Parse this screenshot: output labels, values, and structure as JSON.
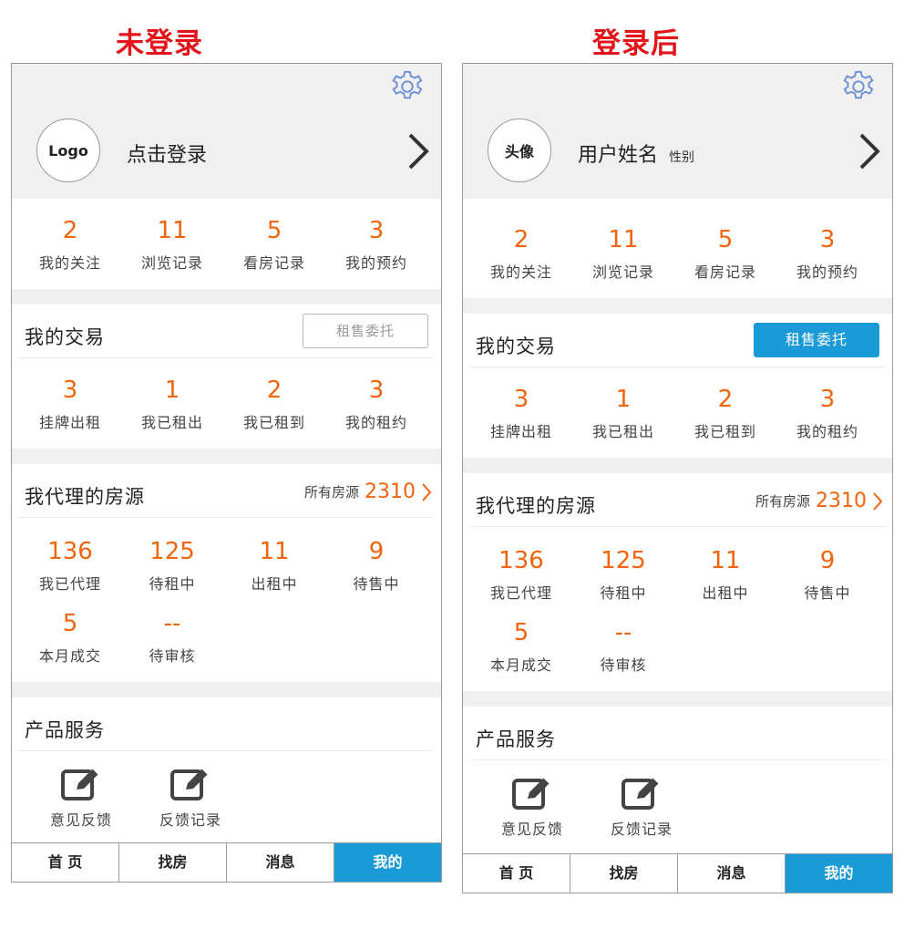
{
  "captions": {
    "before": "未登录",
    "after": "登录后"
  },
  "colors": {
    "accent_orange": "#f0640c",
    "accent_blue": "#1a9bd7",
    "caption_red": "#e3151b"
  },
  "before": {
    "avatar_text": "Logo",
    "name": "点击登录",
    "gender": "",
    "stats": [
      {
        "num": "2",
        "label": "我的关注"
      },
      {
        "num": "11",
        "label": "浏览记录"
      },
      {
        "num": "5",
        "label": "看房记录"
      },
      {
        "num": "3",
        "label": "我的预约"
      }
    ],
    "trade": {
      "title": "我的交易",
      "button": "租售委托",
      "button_state": "disabled",
      "stats": [
        {
          "num": "3",
          "label": "挂牌出租"
        },
        {
          "num": "1",
          "label": "我已租出"
        },
        {
          "num": "2",
          "label": "我已租到"
        },
        {
          "num": "3",
          "label": "我的租约"
        }
      ]
    },
    "agency": {
      "title": "我代理的房源",
      "all_label": "所有房源",
      "all_count": "2310",
      "stats": [
        {
          "num": "136",
          "label": "我已代理"
        },
        {
          "num": "125",
          "label": "待租中"
        },
        {
          "num": "11",
          "label": "出租中"
        },
        {
          "num": "9",
          "label": "待售中"
        },
        {
          "num": "5",
          "label": "本月成交"
        },
        {
          "num": "--",
          "label": "待审核"
        }
      ]
    },
    "services": {
      "title": "产品服务",
      "items": [
        {
          "label": "意见反馈",
          "icon": "edit-icon"
        },
        {
          "label": "反馈记录",
          "icon": "edit-icon"
        }
      ]
    },
    "tabs": [
      "首 页",
      "找房",
      "消息",
      "我的"
    ],
    "active_tab": 3
  },
  "after": {
    "avatar_text": "头像",
    "name": "用户姓名",
    "gender": "性别",
    "stats": [
      {
        "num": "2",
        "label": "我的关注"
      },
      {
        "num": "11",
        "label": "浏览记录"
      },
      {
        "num": "5",
        "label": "看房记录"
      },
      {
        "num": "3",
        "label": "我的预约"
      }
    ],
    "trade": {
      "title": "我的交易",
      "button": "租售委托",
      "button_state": "enabled",
      "stats": [
        {
          "num": "3",
          "label": "挂牌出租"
        },
        {
          "num": "1",
          "label": "我已租出"
        },
        {
          "num": "2",
          "label": "我已租到"
        },
        {
          "num": "3",
          "label": "我的租约"
        }
      ]
    },
    "agency": {
      "title": "我代理的房源",
      "all_label": "所有房源",
      "all_count": "2310",
      "stats": [
        {
          "num": "136",
          "label": "我已代理"
        },
        {
          "num": "125",
          "label": "待租中"
        },
        {
          "num": "11",
          "label": "出租中"
        },
        {
          "num": "9",
          "label": "待售中"
        },
        {
          "num": "5",
          "label": "本月成交"
        },
        {
          "num": "--",
          "label": "待审核"
        }
      ]
    },
    "services": {
      "title": "产品服务",
      "items": [
        {
          "label": "意见反馈",
          "icon": "edit-icon"
        },
        {
          "label": "反馈记录",
          "icon": "edit-icon"
        }
      ]
    },
    "tabs": [
      "首 页",
      "找房",
      "消息",
      "我的"
    ],
    "active_tab": 3
  }
}
